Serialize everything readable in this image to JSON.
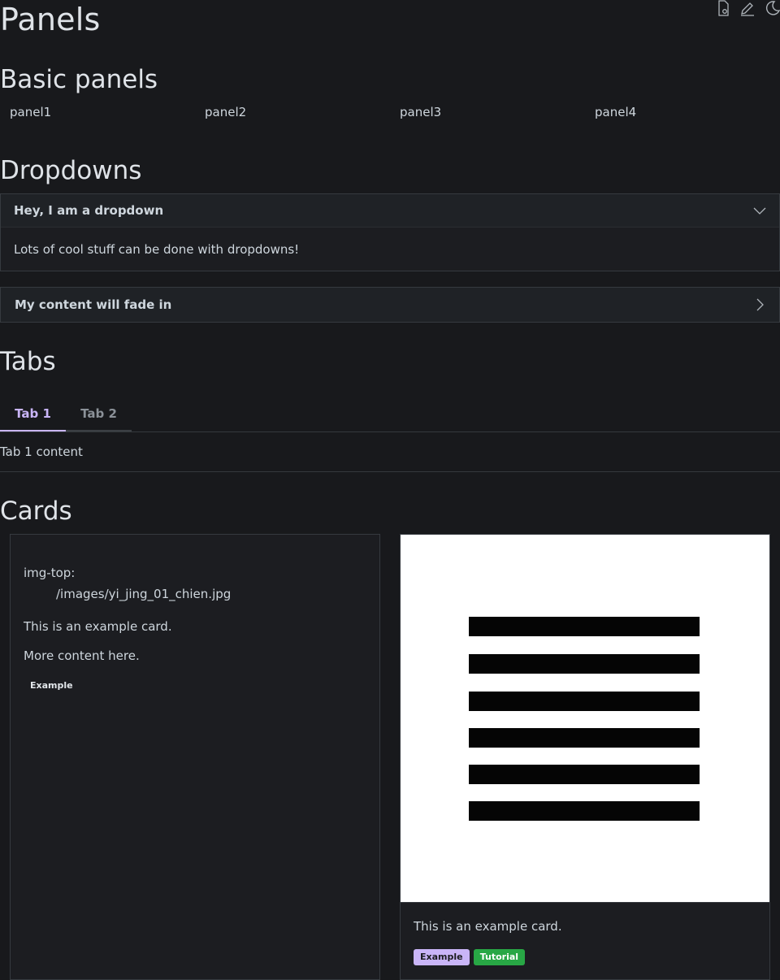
{
  "page": {
    "title": "Panels"
  },
  "toolbar": {
    "icons": [
      "source-file-icon",
      "edit-icon",
      "dark-mode-icon"
    ]
  },
  "sections": {
    "basic_panels": "Basic panels",
    "dropdowns": "Dropdowns",
    "tabs": "Tabs",
    "cards": "Cards"
  },
  "panels": [
    "panel1",
    "panel2",
    "panel3",
    "panel4"
  ],
  "dropdowns": [
    {
      "title": "Hey, I am a dropdown",
      "content": "Lots of cool stuff can be done with dropdowns!",
      "expanded": true
    },
    {
      "title": "My content will fade in",
      "content": "",
      "expanded": false
    }
  ],
  "tabs": {
    "items": [
      {
        "label": "Tab 1",
        "active": true
      },
      {
        "label": "Tab 2",
        "active": false
      }
    ],
    "content": "Tab 1 content"
  },
  "cards": [
    {
      "img_top_label": "img-top:",
      "img_top_path": "/images/yi_jing_01_chien.jpg",
      "text": "This is an example card.",
      "more": "More content here.",
      "badges": [
        "Example"
      ]
    },
    {
      "image": "hexagram-six-solid-lines",
      "text": "This is an example card.",
      "badges": [
        "Example",
        "Tutorial"
      ]
    }
  ],
  "colors": {
    "accent": "#c9b5f7",
    "success": "#28a745",
    "background": "#18191c"
  }
}
